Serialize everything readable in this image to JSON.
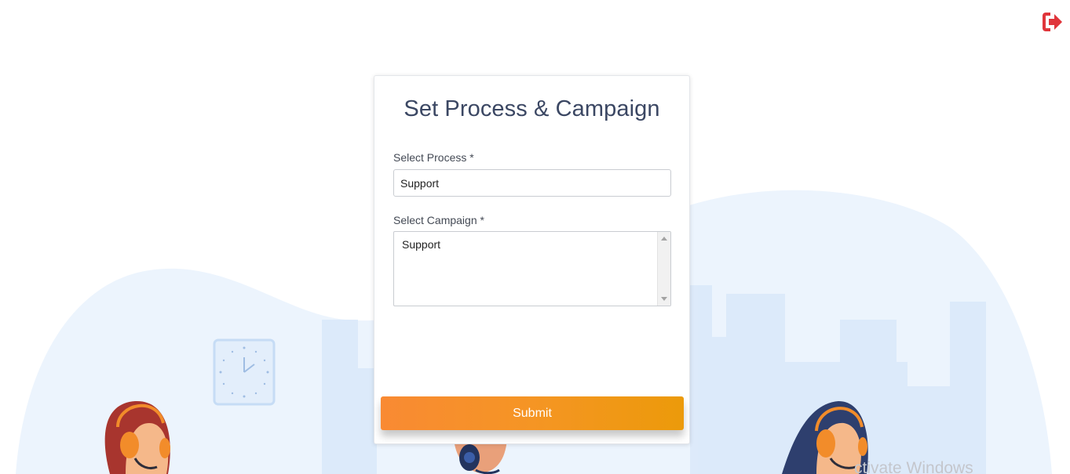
{
  "header": {
    "logout_icon": "sign-out-icon",
    "logout_color": "#e0353b"
  },
  "form": {
    "title": "Set Process & Campaign",
    "process_label": "Select Process *",
    "process_value": "Support",
    "campaign_label": "Select Campaign *",
    "campaign_options": [
      "Support"
    ],
    "submit_label": "Submit"
  },
  "colors": {
    "title": "#3b4763",
    "submit_start": "#f98a33",
    "submit_end": "#ec9a0a",
    "background_wave": "#e9f2fc"
  },
  "watermark": {
    "text": "ctivate Windows"
  }
}
